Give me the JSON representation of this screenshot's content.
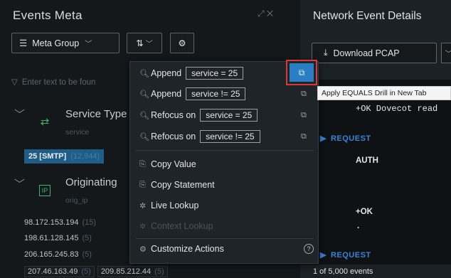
{
  "left_panel": {
    "title": "Events Meta",
    "title_icons": "⤢  ✕",
    "meta_group_label": "Meta Group",
    "filter_placeholder": "Enter text to be foun",
    "groups": [
      {
        "title": "Service Type",
        "sub": "service"
      },
      {
        "title": "Originating",
        "sub": "orig_ip"
      }
    ],
    "smtp_value": "25 [SMTP]",
    "smtp_count": "(12,944)",
    "ip_rows": [
      {
        "ip": "98.172.153.194",
        "count": "(15)"
      },
      {
        "ip": "198.61.128.145",
        "count": "(5)"
      },
      {
        "ip": "206.165.245.83",
        "count": "(5)"
      }
    ],
    "ip_last": [
      {
        "ip": "207.46.163.49",
        "count": "(5)"
      },
      {
        "ip": "209.85.212.44",
        "count": "(5)"
      }
    ]
  },
  "right_panel": {
    "title": "Network Event Details",
    "download_label": "Download PCAP",
    "line1": "+OK Dovecot read",
    "request_label": "REQUEST",
    "auth_text": "AUTH",
    "ok_text": "+OK",
    "dot_text": ".",
    "request_label_2": "REQUEST",
    "footer": "1 of 5,000 events"
  },
  "context_menu": {
    "items": [
      {
        "verb": "Append",
        "chip": "service = 25"
      },
      {
        "verb": "Append",
        "chip": "service != 25"
      },
      {
        "verb": "Refocus on",
        "chip": "service = 25"
      },
      {
        "verb": "Refocus on",
        "chip": "service != 25"
      }
    ],
    "copy_value": "Copy Value",
    "copy_statement": "Copy Statement",
    "live_lookup": "Live Lookup",
    "context_lookup": "Context Lookup",
    "customize_actions": "Customize Actions"
  },
  "tooltip": "Apply EQUALS Drill in New Tab",
  "colors": {
    "accent_blue": "#2a7fc4",
    "highlight_red": "#d83a3a",
    "request_blue": "#3a84d6",
    "service_green": "#3db374"
  }
}
